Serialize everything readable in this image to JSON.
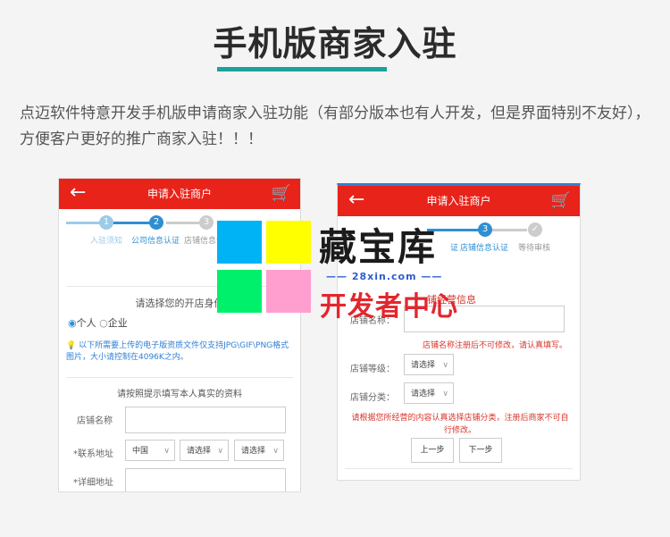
{
  "heading": "手机版商家入驻",
  "intro": "点迈软件特意开发手机版申请商家入驻功能（有部分版本也有人开发，但是界面特别不友好），方便客户更好的推广商家入驻！！！",
  "colors": {
    "accent": "#1aa39a",
    "appbar": "#e8231a",
    "step_active": "#2f8fd3",
    "step_done": "#9ccbe8",
    "step_todo": "#cccccc"
  },
  "left_phone": {
    "title": "申请入驻商户",
    "back_icon": "arrow-left-icon",
    "cart_icon": "cart-icon",
    "steps": [
      {
        "num": "1",
        "label": "入驻须知"
      },
      {
        "num": "2",
        "label": "公司信息认证"
      },
      {
        "num": "3",
        "label": "店铺信息认"
      }
    ],
    "identity_prompt": "请选择您的开店身份",
    "identity_options": [
      "个人",
      "企业"
    ],
    "upload_tip": "以下所需要上传的电子版资质文件仅支持JPG\\GIF\\PNG格式图片，大小请控制在4096K之内。",
    "fill_prompt": "请按照提示填写本人真实的资料",
    "fields": {
      "shop_name_label": "店铺名称",
      "address_label": "*联系地址",
      "address_country": "中国",
      "address_province": "请选择",
      "address_city": "请选择",
      "detail_address_label": "*详细地址"
    }
  },
  "right_phone": {
    "title": "申请入驻商户",
    "back_icon": "arrow-left-icon",
    "cart_icon": "cart-icon",
    "steps": [
      {
        "num": "3",
        "label": "店铺信息认证"
      },
      {
        "num": "✓",
        "label": "等待审核"
      }
    ],
    "step_prefix_label": "证",
    "section_title": "铺经营信息",
    "shop_name_label": "店铺名称：",
    "shop_name_note": "店铺名称注册后不可修改，请认真填写。",
    "shop_level_label": "店铺等级：",
    "shop_level_value": "请选择",
    "shop_category_label": "店铺分类：",
    "shop_category_value": "请选择",
    "category_note": "请根据您所经营的内容认真选择店铺分类，注册后商家不可自行修改。",
    "prev_button": "上一步",
    "next_button": "下一步"
  },
  "watermark": {
    "title": "藏宝库",
    "site": "—— 28xin.com ——",
    "subtitle": "开发者中心"
  }
}
